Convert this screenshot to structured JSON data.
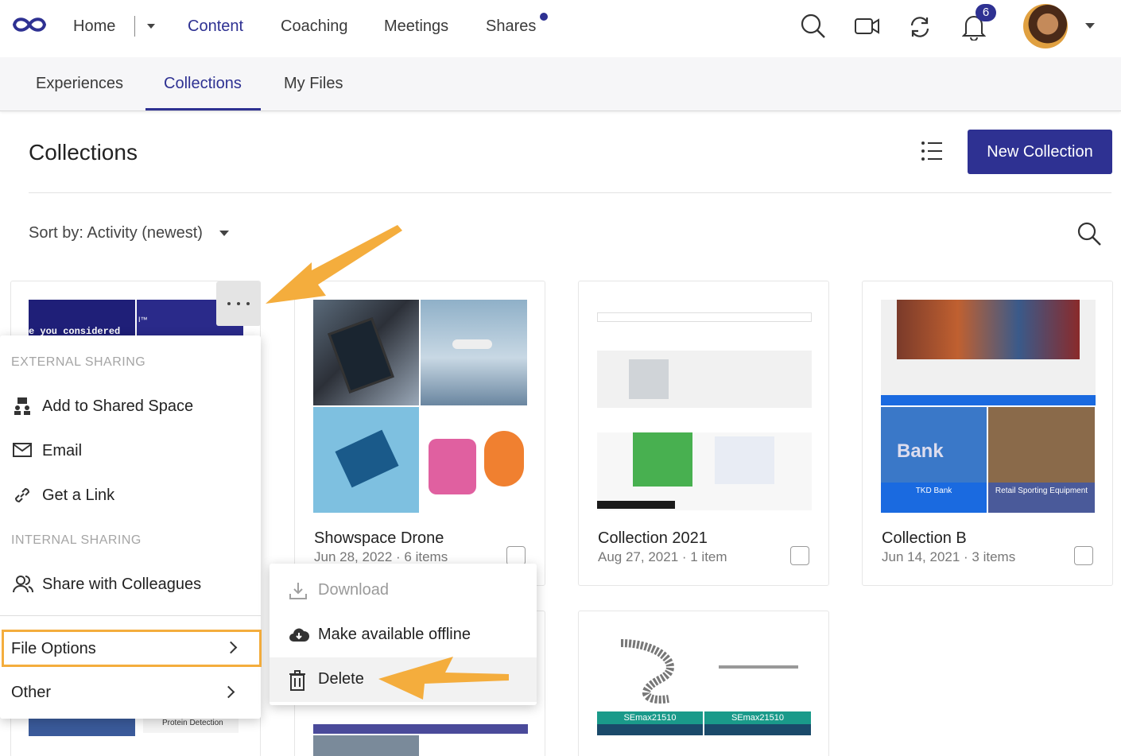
{
  "topnav": {
    "home": "Home",
    "content": "Content",
    "coaching": "Coaching",
    "meetings": "Meetings",
    "shares": "Shares",
    "notifications_count": "6"
  },
  "subnav": {
    "tabs": [
      "Experiences",
      "Collections",
      "My Files"
    ]
  },
  "page": {
    "title": "Collections",
    "new_button": "New Collection",
    "sort_label": "Sort by: Activity (newest)"
  },
  "cards": [
    {
      "title": "Showspace Drone",
      "meta": "Jun 28, 2022 · 6 items"
    },
    {
      "title": "Collection 2021",
      "meta": "Aug 27, 2021 · 1 item"
    },
    {
      "title": "Collection B",
      "meta": "Jun 14, 2021 · 3 items"
    }
  ],
  "card_thumb_texts": {
    "partial_top": "e you considered",
    "partial_top2": "I™",
    "tkd": "TKD Bank",
    "retail": "Retail Sporting Equipment",
    "bank_sign": "Bank",
    "semax": "SEmax21510",
    "protein": "Protein Detection"
  },
  "context_menu": {
    "external_header": "EXTERNAL SHARING",
    "add_shared": "Add to Shared Space",
    "email": "Email",
    "get_link": "Get a Link",
    "internal_header": "INTERNAL SHARING",
    "share_colleagues": "Share with Colleagues",
    "file_options": "File Options",
    "other": "Other"
  },
  "submenu": {
    "download": "Download",
    "offline": "Make available offline",
    "delete": "Delete"
  },
  "colors": {
    "brand": "#2e3192",
    "highlight": "#f4ad3d"
  }
}
